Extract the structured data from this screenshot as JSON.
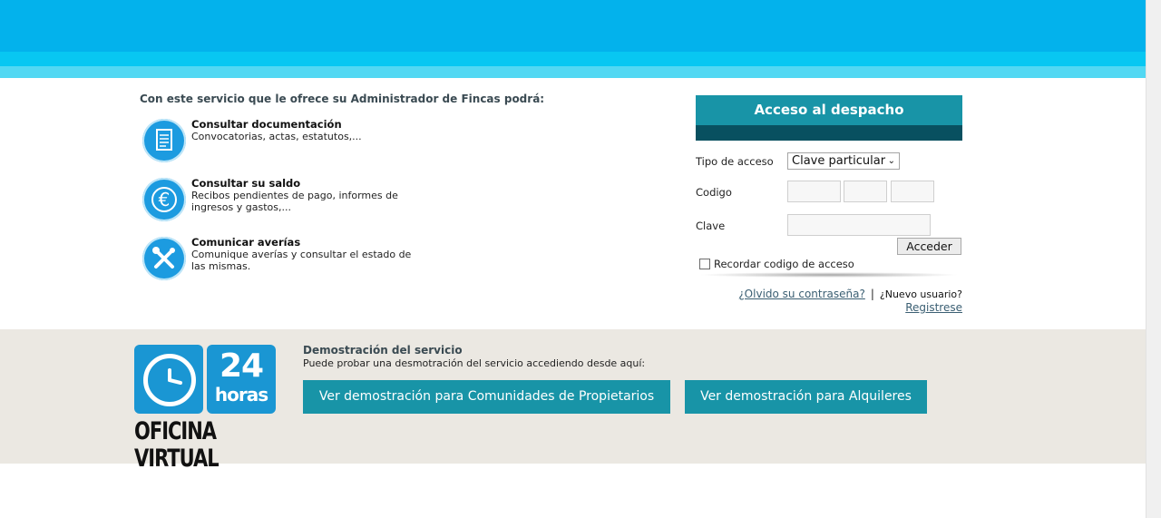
{
  "intro": "Con este servicio que le ofrece su Administrador de Fincas podrá:",
  "features": [
    {
      "title": "Consultar documentación",
      "desc": "Convocatorias, actas, estatutos,..."
    },
    {
      "title": "Consultar su saldo",
      "desc": "Recibos pendientes de pago, informes de ingresos y gastos,..."
    },
    {
      "title": "Comunicar averías",
      "desc": "Comunique averías y consultar el estado de las mismas."
    }
  ],
  "login": {
    "title": "Acceso al despacho",
    "tipo_label": "Tipo de acceso",
    "tipo_value": "Clave particular",
    "codigo_label": "Codigo",
    "clave_label": "Clave",
    "submit": "Acceder",
    "remember": "Recordar codigo de acceso",
    "forgot": "¿Olvido su contraseña?",
    "separator": "|",
    "new_user": "¿Nuevo usuario?",
    "register": "Registrese"
  },
  "logo": {
    "number": "24",
    "horas": "horas",
    "name": "OFICINA VIRTUAL"
  },
  "demo": {
    "title": "Demostración del servicio",
    "subtitle": "Puede probar una desmotración del servicio accediendo desde aquí:",
    "btn_comunidades": "Ver demostración para Comunidades de Propietarios",
    "btn_alquileres": "Ver demostración para Alquileres"
  },
  "colors": {
    "header": "#03b2ec",
    "accent": "#1894a7",
    "accent_dark": "#085060",
    "icon_blue": "#1c9be0"
  }
}
